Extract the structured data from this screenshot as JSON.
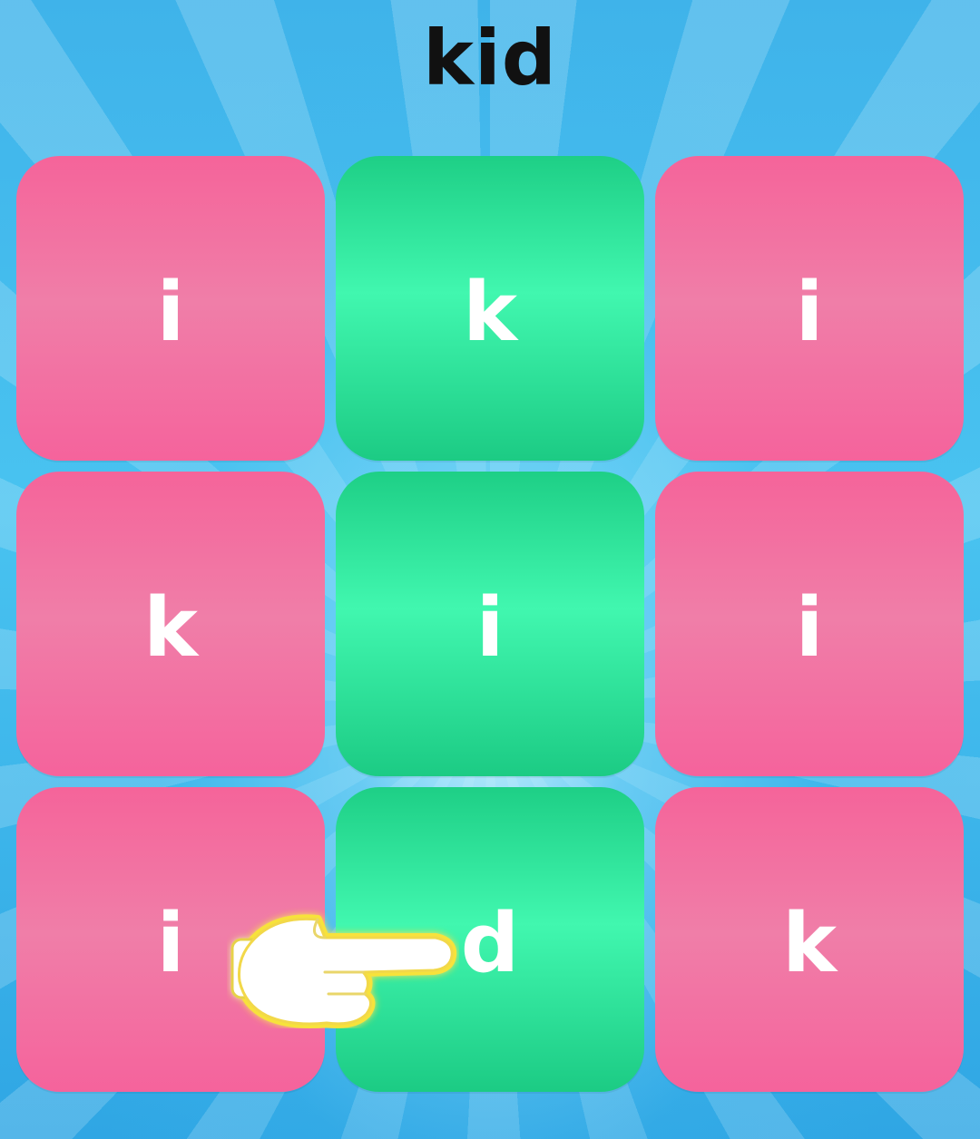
{
  "game": {
    "target_word": "kid",
    "tiles": [
      {
        "letter": "i",
        "color": "pink"
      },
      {
        "letter": "k",
        "color": "green"
      },
      {
        "letter": "i",
        "color": "pink"
      },
      {
        "letter": "k",
        "color": "pink"
      },
      {
        "letter": "i",
        "color": "green"
      },
      {
        "letter": "i",
        "color": "pink"
      },
      {
        "letter": "i",
        "color": "pink"
      },
      {
        "letter": "d",
        "color": "green"
      },
      {
        "letter": "k",
        "color": "pink"
      }
    ]
  },
  "hint": {
    "icon": "pointing-hand-icon"
  },
  "colors": {
    "pink_tile": "#f07ea8",
    "green_tile": "#41f7af",
    "background": "#36b6ea",
    "title_text": "#111111",
    "tile_text": "#ffffff"
  }
}
